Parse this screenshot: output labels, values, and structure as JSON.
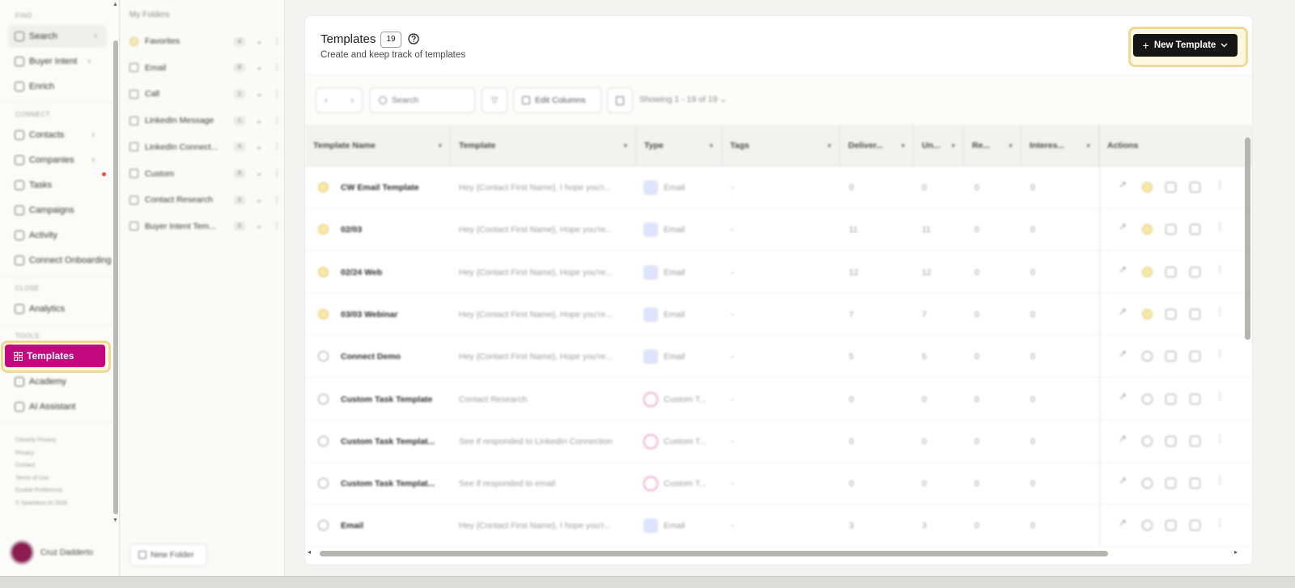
{
  "sidebar": {
    "sections": [
      {
        "label": "FIND",
        "items": [
          {
            "label": "Search",
            "icon": "search-icon",
            "chevron": true
          },
          {
            "label": "Buyer Intent",
            "icon": "buyer-intent-icon",
            "chevron": true
          },
          {
            "label": "Enrich",
            "icon": "enrich-icon",
            "chevron": false
          }
        ]
      },
      {
        "label": "CONNECT",
        "items": [
          {
            "label": "Contacts",
            "icon": "contacts-icon",
            "chevron": true
          },
          {
            "label": "Companies",
            "icon": "companies-icon",
            "chevron": true
          },
          {
            "label": "Tasks",
            "icon": "tasks-icon",
            "chevron": false
          },
          {
            "label": "Campaigns",
            "icon": "campaigns-icon",
            "chevron": false
          },
          {
            "label": "Activity",
            "icon": "activity-icon",
            "chevron": false
          },
          {
            "label": "Connect Onboarding",
            "icon": "onboarding-icon",
            "chevron": false
          }
        ]
      },
      {
        "label": "CLOSE",
        "items": [
          {
            "label": "Analytics",
            "icon": "analytics-icon",
            "chevron": false
          }
        ]
      },
      {
        "label": "TOOLS",
        "items": [
          {
            "label": "Templates",
            "icon": "grid-icon",
            "active": true
          },
          {
            "label": "Academy",
            "icon": "academy-icon"
          },
          {
            "label": "AI Assistant",
            "icon": "ai-assistant-icon"
          }
        ]
      }
    ],
    "footer_links": [
      "Cleverly Privacy",
      "Privacy",
      "Contact",
      "Terms of Use",
      "Cookie Preference",
      "© Seamless.AI 2026"
    ],
    "user_name": "Cruz Dadderto"
  },
  "folders": {
    "title": "My Folders",
    "items": [
      {
        "label": "Favorites",
        "count": "4",
        "favorite": true
      },
      {
        "label": "Email",
        "count": "8"
      },
      {
        "label": "Call",
        "count": "1"
      },
      {
        "label": "LinkedIn Message",
        "count": "1"
      },
      {
        "label": "LinkedIn Connect...",
        "count": "4"
      },
      {
        "label": "Custom",
        "count": "8"
      },
      {
        "label": "Contact Research",
        "count": "0"
      },
      {
        "label": "Buyer Intent Tem...",
        "count": "0"
      }
    ],
    "new_folder_label": "New Folder"
  },
  "header": {
    "title": "Templates",
    "count": "19",
    "subtitle": "Create and keep track of templates",
    "new_template_label": "New Template"
  },
  "toolbar": {
    "search_placeholder": "Search",
    "edit_columns_label": "Edit Columns",
    "showing_label": "Showing 1 - 19 of 19"
  },
  "table": {
    "columns": [
      "Template Name",
      "Template",
      "Type",
      "Tags",
      "Deliver...",
      "Un...",
      "Re...",
      "Interes...",
      "Actions"
    ],
    "rows": [
      {
        "favorite": true,
        "name": "CW Email Template",
        "template": "Hey {Contact First Name}, I hope you'r...",
        "type": "Email",
        "type_kind": "email",
        "tags": "-",
        "delivered": "0",
        "unique": "0",
        "replied": "0",
        "interested": "0"
      },
      {
        "favorite": true,
        "name": "02/03",
        "template": "Hey {Contact First Name}, Hope you're...",
        "type": "Email",
        "type_kind": "email",
        "tags": "-",
        "delivered": "11",
        "unique": "11",
        "replied": "0",
        "interested": "0"
      },
      {
        "favorite": true,
        "name": "02/24 Web",
        "template": "Hey {Contact First Name}, Hope you're...",
        "type": "Email",
        "type_kind": "email",
        "tags": "-",
        "delivered": "12",
        "unique": "12",
        "replied": "0",
        "interested": "0"
      },
      {
        "favorite": true,
        "name": "03/03 Webinar",
        "template": "Hey {Contact First Name}, Hope you're...",
        "type": "Email",
        "type_kind": "email",
        "tags": "-",
        "delivered": "7",
        "unique": "7",
        "replied": "0",
        "interested": "0"
      },
      {
        "favorite": false,
        "name": "Connect Demo",
        "template": "Hey {Contact First Name}, Hope you're...",
        "type": "Email",
        "type_kind": "email",
        "tags": "-",
        "delivered": "5",
        "unique": "5",
        "replied": "0",
        "interested": "0"
      },
      {
        "favorite": false,
        "name": "Custom Task Template",
        "template": "Contact Research",
        "type": "Custom T...",
        "type_kind": "task",
        "tags": "-",
        "delivered": "0",
        "unique": "0",
        "replied": "0",
        "interested": "0"
      },
      {
        "favorite": false,
        "name": "Custom Task Templat...",
        "template": "See if responded to LinkedIn Connection",
        "type": "Custom T...",
        "type_kind": "task",
        "tags": "-",
        "delivered": "0",
        "unique": "0",
        "replied": "0",
        "interested": "0"
      },
      {
        "favorite": false,
        "name": "Custom Task Templat...",
        "template": "See if responded to email",
        "type": "Custom T...",
        "type_kind": "task",
        "tags": "-",
        "delivered": "0",
        "unique": "0",
        "replied": "0",
        "interested": "0"
      },
      {
        "favorite": false,
        "name": "Email",
        "template": "Hey {Contact First Name}, I hope you'r...",
        "type": "Email",
        "type_kind": "email",
        "tags": "-",
        "delivered": "3",
        "unique": "3",
        "replied": "0",
        "interested": "0"
      }
    ]
  },
  "colors": {
    "active_nav": "#c2077f",
    "highlight": "#f1d893",
    "primary_button": "#161616"
  }
}
